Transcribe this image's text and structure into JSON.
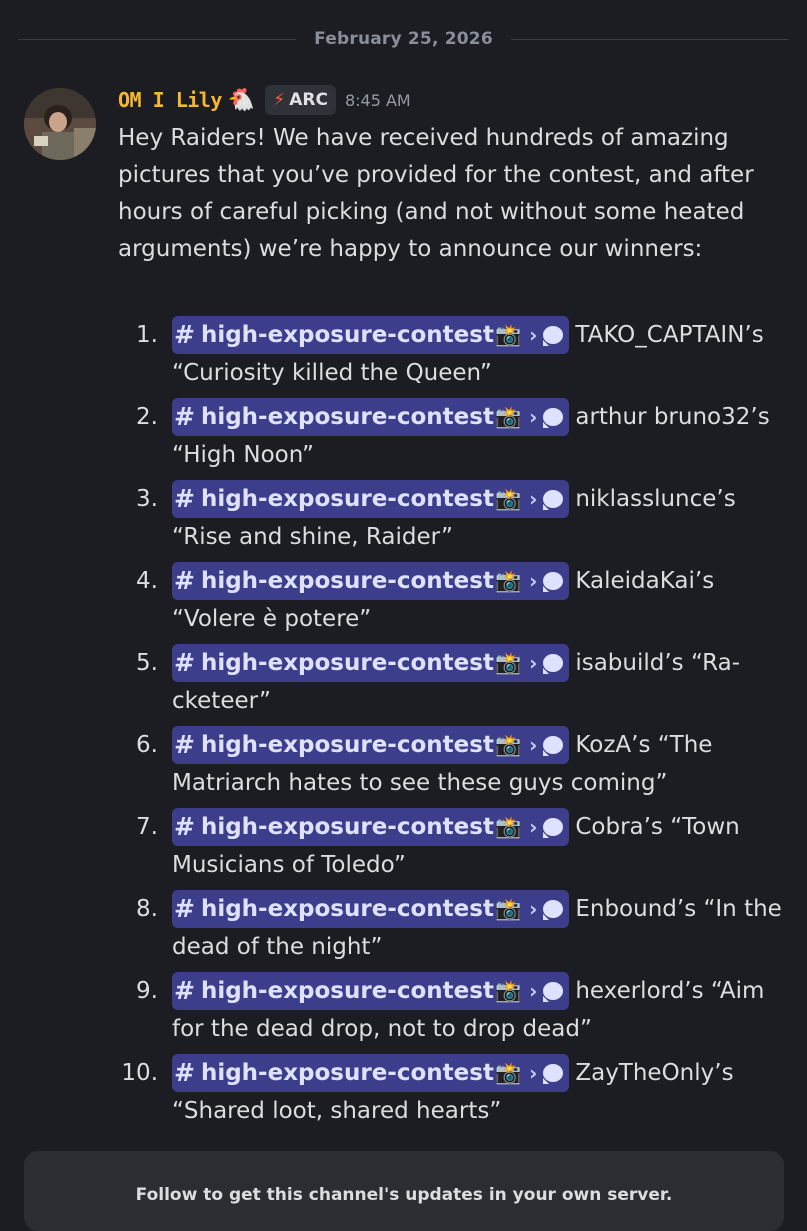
{
  "date": "February 25, 2026",
  "message": {
    "username": "OM I Lily",
    "username_emoji": "🐔",
    "tag": {
      "icon": "⚡",
      "label": "ARC"
    },
    "timestamp": "8:45 AM",
    "intro": "Hey Raiders! We have received hundreds of amazing pictures that you’ve provided for the contest, and after hours of careful picking (and not without some heated arguments) we’re happy to announce our winners:"
  },
  "mention": {
    "hash": "#",
    "channel": "high-exposure-contest",
    "channel_emoji": "📸",
    "chevron": "›"
  },
  "winners": [
    {
      "num": "1.",
      "text": "TAKO_CAPTAIN’s “Curiosity killed the Queen”"
    },
    {
      "num": "2.",
      "text": "arthur bruno32’s “High Noon”"
    },
    {
      "num": "3.",
      "text": "niklasslunce’s “Rise and shine, Raider”"
    },
    {
      "num": "4.",
      "text": "KaleidaKai’s “Volere è potere”"
    },
    {
      "num": "5.",
      "text": "isabuild’s “Ra-cketeer”"
    },
    {
      "num": "6.",
      "text": "KozA’s “The Matriarch hates to see these guys coming”"
    },
    {
      "num": "7.",
      "text": "Cobra’s “Town Musicians of Toledo”"
    },
    {
      "num": "8.",
      "text": "Enbound’s “In the dead of the night”"
    },
    {
      "num": "9.",
      "text": "hexerlord’s “Aim for the dead drop, not to drop dead”"
    },
    {
      "num": "10.",
      "text": "ZayTheOnly’s “Shared loot, shared hearts”"
    }
  ],
  "follow_card": {
    "text": "Follow to get this channel's updates in your own server."
  }
}
